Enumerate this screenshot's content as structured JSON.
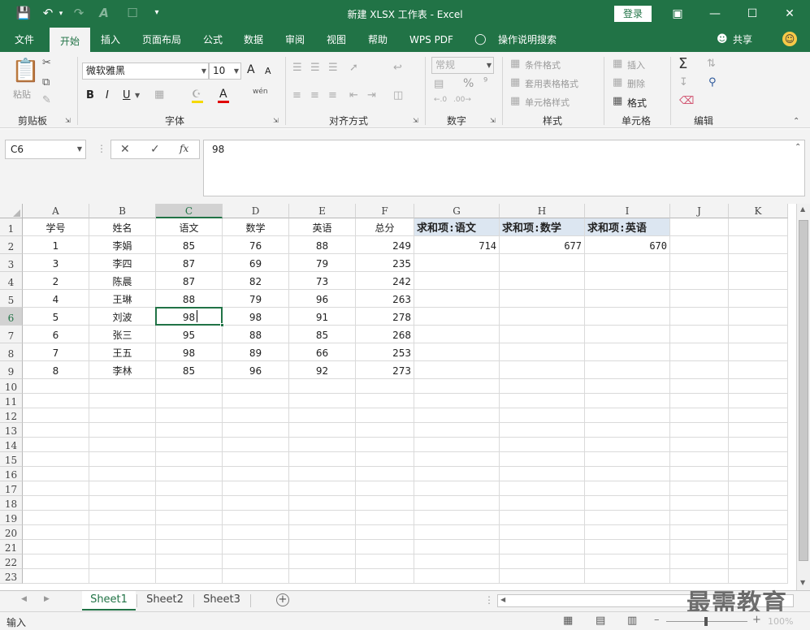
{
  "titlebar": {
    "title": "新建 XLSX 工作表 - Excel",
    "login": "登录"
  },
  "tabs": [
    "文件",
    "开始",
    "插入",
    "页面布局",
    "公式",
    "数据",
    "审阅",
    "视图",
    "帮助",
    "WPS PDF",
    "操作说明搜索",
    "共享"
  ],
  "ribbon": {
    "clipboard": {
      "paste": "粘贴",
      "label": "剪贴板"
    },
    "font": {
      "name": "微软雅黑",
      "size": "10",
      "bold": "B",
      "italic": "I",
      "underline": "U",
      "grow": "A",
      "shrink": "A",
      "color": "A",
      "pinyin": "wén",
      "label": "字体"
    },
    "align": {
      "label": "对齐方式"
    },
    "number": {
      "format": "常规",
      "percent": "%",
      "comma": "⁹",
      "label": "数字"
    },
    "styles": {
      "cond": "条件格式",
      "table": "套用表格格式",
      "cell": "单元格样式",
      "label": "样式"
    },
    "cells": {
      "insert": "插入",
      "delete": "删除",
      "format": "格式",
      "label": "单元格"
    },
    "editing": {
      "label": "编辑"
    }
  },
  "formula": {
    "namebox": "C6",
    "cancel": "✕",
    "enter": "✓",
    "fx": "fx",
    "value": "98"
  },
  "columns": [
    "A",
    "B",
    "C",
    "D",
    "E",
    "F",
    "G",
    "H",
    "I",
    "J",
    "K"
  ],
  "rows": [
    "1",
    "2",
    "3",
    "4",
    "5",
    "6",
    "7",
    "8",
    "9",
    "10",
    "11",
    "12",
    "13",
    "14",
    "15",
    "16",
    "17",
    "18",
    "19",
    "20",
    "21",
    "22",
    "23"
  ],
  "table": {
    "headers": [
      "学号",
      "姓名",
      "语文",
      "数学",
      "英语",
      "总分"
    ],
    "data": [
      [
        "1",
        "李娟",
        "85",
        "76",
        "88",
        "249"
      ],
      [
        "3",
        "李四",
        "87",
        "69",
        "79",
        "235"
      ],
      [
        "2",
        "陈晨",
        "87",
        "82",
        "73",
        "242"
      ],
      [
        "4",
        "王琳",
        "88",
        "79",
        "96",
        "263"
      ],
      [
        "5",
        "刘波",
        "98",
        "98",
        "91",
        "278"
      ],
      [
        "6",
        "张三",
        "95",
        "88",
        "85",
        "268"
      ],
      [
        "7",
        "王五",
        "98",
        "89",
        "66",
        "253"
      ],
      [
        "8",
        "李林",
        "85",
        "96",
        "92",
        "273"
      ]
    ]
  },
  "pivot": {
    "headers": [
      "求和项:语文",
      "求和项:数学",
      "求和项:英语"
    ],
    "values": [
      "714",
      "677",
      "670"
    ]
  },
  "sheets": [
    "Sheet1",
    "Sheet2",
    "Sheet3"
  ],
  "status": {
    "mode": "输入",
    "zoom": "100%"
  },
  "watermark": "最需教育",
  "colors": {
    "accent": "#217346",
    "pivot": "#dce6f1"
  }
}
